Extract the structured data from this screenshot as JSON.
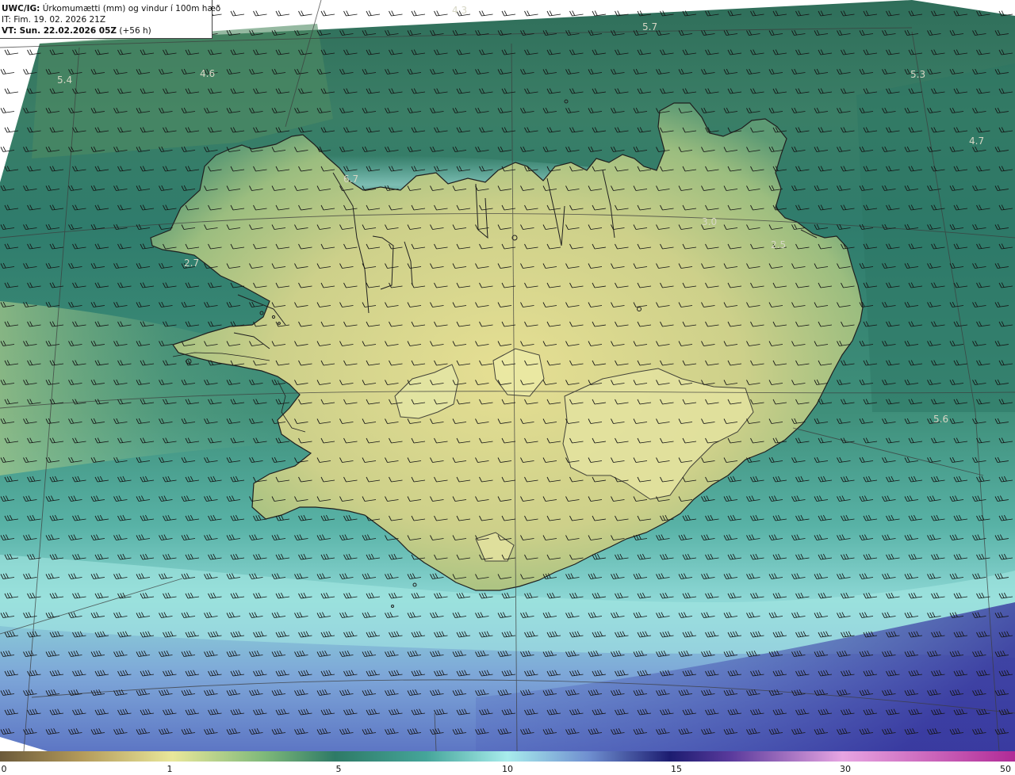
{
  "header": {
    "source": "UWC/IG:",
    "title": " Úrkomumætti (mm) og vindur í 100m hæð",
    "initial_time": "IT: Fim. 19. 02. 2026 21Z",
    "valid_time": "VT: Sun. 22.02.2026 05Z",
    "lead": " (+56 h)"
  },
  "map_values": [
    "4.3",
    "5.7",
    "5.4",
    "4.6",
    "5.3",
    "4.7",
    "6.7",
    "3.0",
    "2.5",
    "2.7",
    "5.6"
  ],
  "colorbar": {
    "ticks": [
      "0",
      "1",
      "5",
      "10",
      "15",
      "30",
      "50"
    ],
    "colors": [
      "#6b5a3a",
      "#b39a5a",
      "#e9e79a",
      "#7fb97a",
      "#2e7a66",
      "#45a59a",
      "#a8ecec",
      "#6f8fd0",
      "#3a3a9a",
      "#1c1c70",
      "#7a3c9c",
      "#e7a5e2",
      "#b02a96"
    ]
  }
}
